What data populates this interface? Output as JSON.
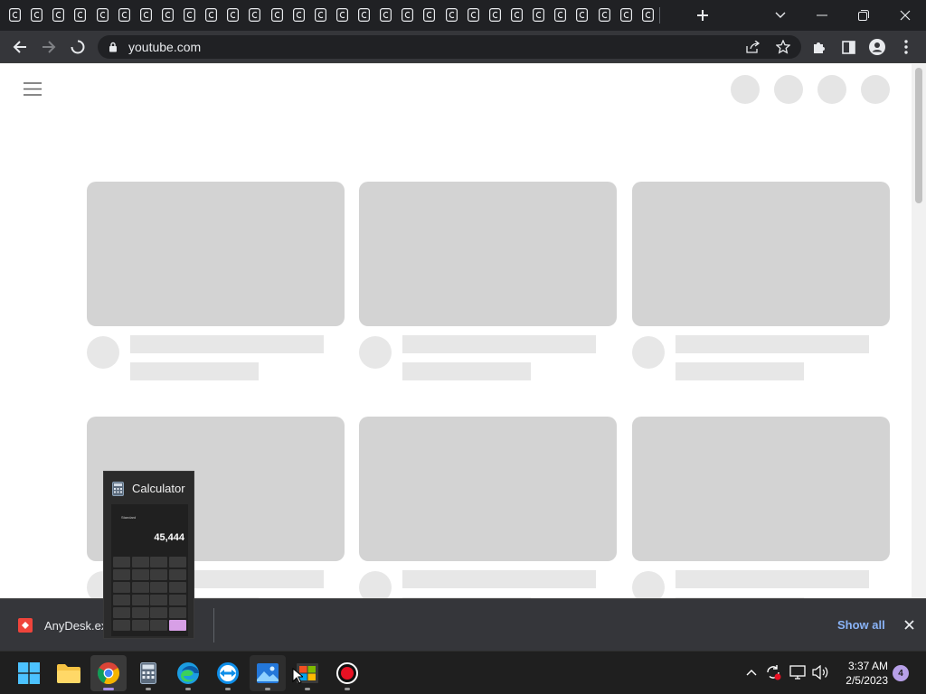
{
  "browser": {
    "tab_count_visible": 30,
    "url": "youtube.com",
    "new_tab_symbol": "+"
  },
  "page": {
    "rows_visible": 2,
    "cards_per_row": 3,
    "loading": true
  },
  "downloads": {
    "file_name": "AnyDesk.exe",
    "show_all_label": "Show all"
  },
  "calculator_preview": {
    "title": "Calculator",
    "mode": "Standard",
    "display_value": "45,444"
  },
  "taskbar": {
    "apps": [
      {
        "name": "Start"
      },
      {
        "name": "File Explorer"
      },
      {
        "name": "Google Chrome",
        "active": true
      },
      {
        "name": "Calculator"
      },
      {
        "name": "Microsoft Edge"
      },
      {
        "name": "TeamViewer"
      },
      {
        "name": "Photos"
      },
      {
        "name": "Microsoft Store"
      },
      {
        "name": "Screen Recorder"
      }
    ],
    "time": "3:37 AM",
    "date": "2/5/2023",
    "notification_count": "4"
  }
}
